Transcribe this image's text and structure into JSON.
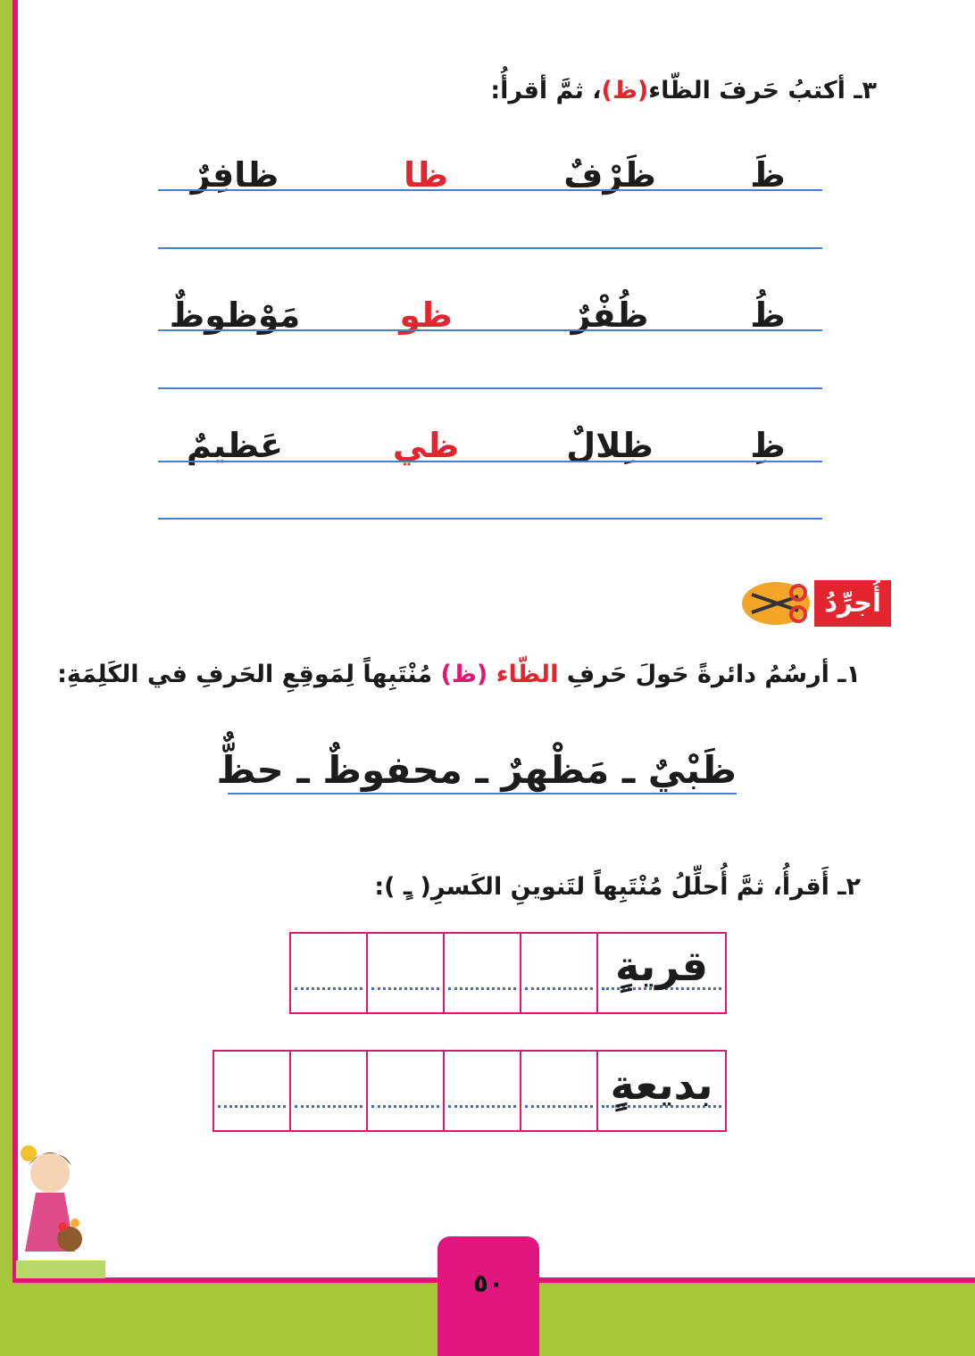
{
  "section3": {
    "heading_prefix": "٣ـ أكتبُ حَرفَ الظّاء",
    "heading_letter": "(ظ)",
    "heading_suffix": "، ثمَّ أقرأُ:",
    "rows": [
      {
        "letter": "ظَ",
        "word1": "ظَرْفٌ",
        "syllable": "ظا",
        "word2": "ظافِرٌ"
      },
      {
        "letter": "ظُ",
        "word1": "ظُفْرٌ",
        "syllable": "ظو",
        "word2": "مَوْظوظٌ"
      },
      {
        "letter": "ظِ",
        "word1": "ظِلالٌ",
        "syllable": "ظي",
        "word2": "عَظيمٌ"
      }
    ]
  },
  "tag_label": "أُجرِّدُ",
  "section1": {
    "heading_prefix": "١ـ أرسُمُ دائرةً حَولَ حَرفِ",
    "heading_red": "الظّاء",
    "heading_pink": "(ظ)",
    "heading_suffix": "مُنْتَبِهاً لِمَوقِعِ الحَرفِ في الكَلِمَةِ:",
    "words_line": "ظَبْيٌ ـ مَظْهرٌ ـ محفوظٌ ـ حظٌّ"
  },
  "section2": {
    "heading": "٢ـ أَقرأُ، ثمَّ أُحلِّلُ مُنْتَبِهاً لتَنوينِ الكَسرِ( ـٍ ):",
    "word1": "قريةٍ",
    "word2": "بديعةٍ"
  },
  "page_number": "٥٠",
  "colors": {
    "frame": "#e21474",
    "accent_red": "#e3252f",
    "green": "#a6c838",
    "guide_blue": "#4a7fc8"
  }
}
